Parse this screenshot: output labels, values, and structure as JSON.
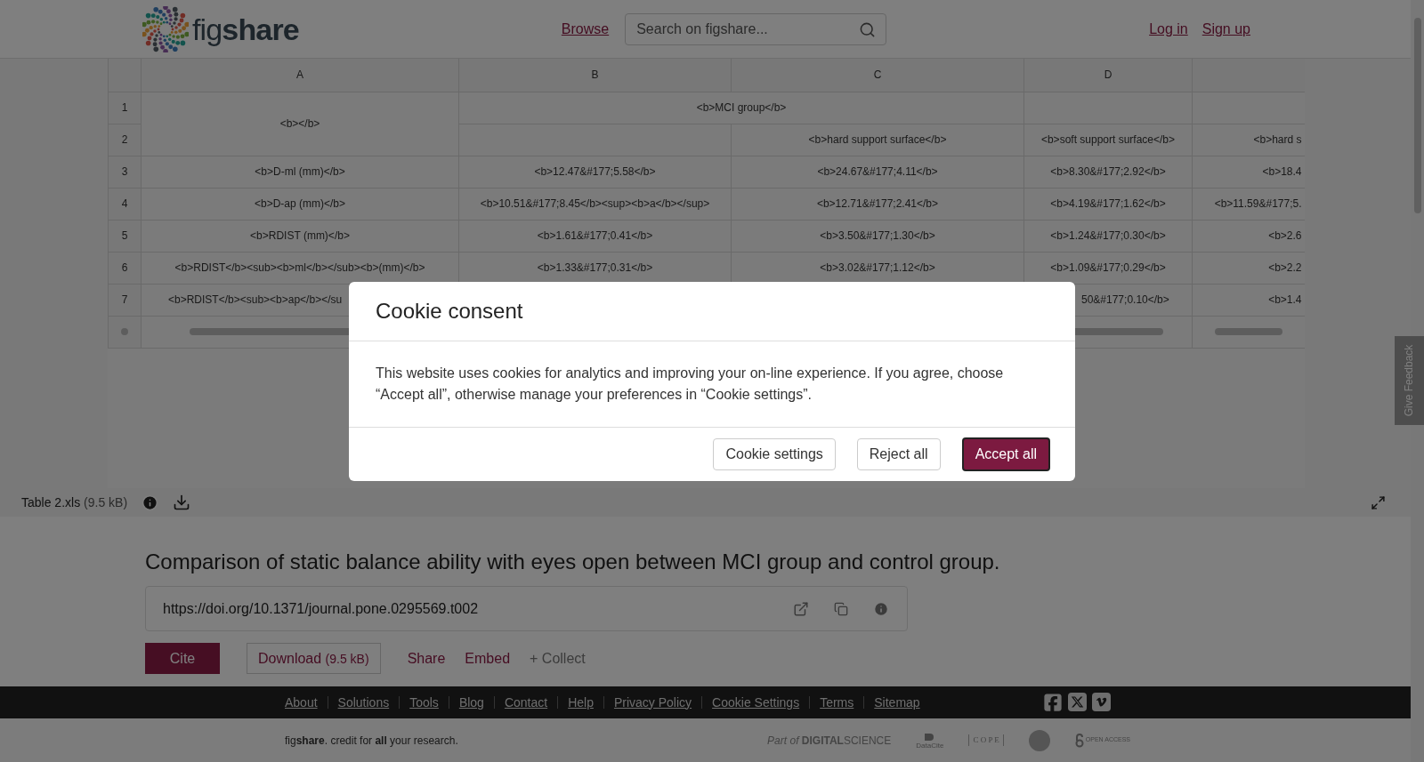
{
  "header": {
    "logo": "fig**share**",
    "nav": [
      {
        "label": "Browse"
      }
    ],
    "search": {
      "placeholder": "Search on figshare..."
    },
    "auth": [
      {
        "label": "Log in"
      },
      {
        "label": "Sign up"
      }
    ]
  },
  "table": {
    "column_headers": [
      "A",
      "B",
      "C",
      "D"
    ],
    "rows": [
      {
        "number": "1",
        "cells": [
          {
            "kind": "text",
            "text": "<b></b>",
            "rowspan": 2
          },
          {
            "kind": "text",
            "text": "<b>MCI group</b>",
            "colspan": 2
          },
          {
            "kind": "empty"
          },
          {
            "kind": "empty"
          }
        ]
      },
      {
        "number": "2",
        "cells": [
          {
            "kind": "empty"
          },
          {
            "kind": "text",
            "text": "<b>hard support surface</b>"
          },
          {
            "kind": "text",
            "text": "<b>soft support surface</b>"
          },
          {
            "kind": "cut",
            "text": "<b>hard s"
          }
        ]
      },
      {
        "number": "3",
        "cells": [
          {
            "kind": "text",
            "text": "<b>D-ml (mm)</b>"
          },
          {
            "kind": "text",
            "text": "<b>12.47&#177;5.58</b>"
          },
          {
            "kind": "text",
            "text": "<b>24.67&#177;4.11</b>"
          },
          {
            "kind": "text",
            "text": "<b>8.30&#177;2.92</b>"
          },
          {
            "kind": "cut",
            "text": "<b>18.4"
          }
        ]
      },
      {
        "number": "4",
        "cells": [
          {
            "kind": "text",
            "text": "<b>D-ap (mm)</b>"
          },
          {
            "kind": "text",
            "text": "<b>10.51&#177;8.45</b><sup><b>a</b></sup>"
          },
          {
            "kind": "text",
            "text": "<b>12.71&#177;2.41</b>"
          },
          {
            "kind": "text",
            "text": "<b>4.19&#177;1.62</b>"
          },
          {
            "kind": "cut",
            "text": "<b>11.59&#177;5."
          }
        ]
      },
      {
        "number": "5",
        "cells": [
          {
            "kind": "text",
            "text": "<b>RDIST (mm)</b>"
          },
          {
            "kind": "text",
            "text": "<b>1.61&#177;0.41</b>"
          },
          {
            "kind": "text",
            "text": "<b>3.50&#177;1.30</b>"
          },
          {
            "kind": "text",
            "text": "<b>1.24&#177;0.30</b>"
          },
          {
            "kind": "cut",
            "text": "<b>2.6"
          }
        ]
      },
      {
        "number": "6",
        "cells": [
          {
            "kind": "text",
            "text": "<b>RDIST</b><sub><b>ml</b></sub><b>(mm)</b>"
          },
          {
            "kind": "text",
            "text": "<b>1.33&#177;0.31</b>"
          },
          {
            "kind": "text",
            "text": "<b>3.02&#177;1.12</b>"
          },
          {
            "kind": "text",
            "text": "<b>1.09&#177;0.29</b>"
          },
          {
            "kind": "cut",
            "text": "<b>2.2"
          }
        ]
      },
      {
        "number": "7",
        "cells": [
          {
            "kind": "cut_right",
            "text": "<b>RDIST</b><sub><b>ap</b></su"
          },
          {
            "kind": "empty"
          },
          {
            "kind": "empty"
          },
          {
            "kind": "cut_left",
            "text": "50&#177;0.10</b>"
          },
          {
            "kind": "cut",
            "text": "<b>1.4"
          }
        ]
      },
      {
        "cells": [
          {
            "kind": "blurred"
          },
          {
            "kind": "empty"
          },
          {
            "kind": "empty"
          },
          {
            "kind": "blurred"
          },
          {
            "kind": "blurred"
          }
        ]
      }
    ]
  },
  "viewer": {
    "file_name": "Table 2.xls",
    "file_size": "(9.5 kB)"
  },
  "article": {
    "title": "Comparison of static balance ability with eyes open between MCI group and control group.",
    "doi": "https://doi.org/10.1371/journal.pone.0295569.t002",
    "actions": [
      {
        "label": "Cite",
        "kind": "primary"
      },
      {
        "label": "Download",
        "size": "(9.5 kB)",
        "kind": "outline"
      },
      {
        "label": "Share",
        "kind": "link"
      },
      {
        "label": "Embed",
        "kind": "link"
      },
      {
        "label": "+ Collect",
        "kind": "muted"
      }
    ]
  },
  "footer": {
    "links": [
      "About",
      "Solutions",
      "Tools",
      "Blog",
      "Contact",
      "Help",
      "Privacy Policy",
      "Cookie Settings",
      "Terms",
      "Sitemap"
    ],
    "tagline": "fig**share**. credit for **all** your research.",
    "partners": [
      {
        "kind": "digital_science",
        "text": "*Part of* **DIGITAL**SCIENCE"
      },
      {
        "kind": "datacite",
        "text": "DataCite"
      },
      {
        "kind": "cope",
        "text": "C O P E"
      },
      {
        "kind": "seal"
      },
      {
        "kind": "open_access",
        "text": "OPEN ACCESS"
      }
    ]
  },
  "feedback_tab": "Give Feedback",
  "cookie_dialog": {
    "title": "Cookie consent",
    "body": "This website uses cookies for analytics and improving your on-line experience. If you agree, choose “Accept all”, otherwise manage your preferences in “Cookie settings”.",
    "buttons": [
      {
        "label": "Cookie settings",
        "kind": "secondary"
      },
      {
        "label": "Reject all",
        "kind": "secondary"
      },
      {
        "label": "Accept all",
        "kind": "primary"
      }
    ]
  }
}
